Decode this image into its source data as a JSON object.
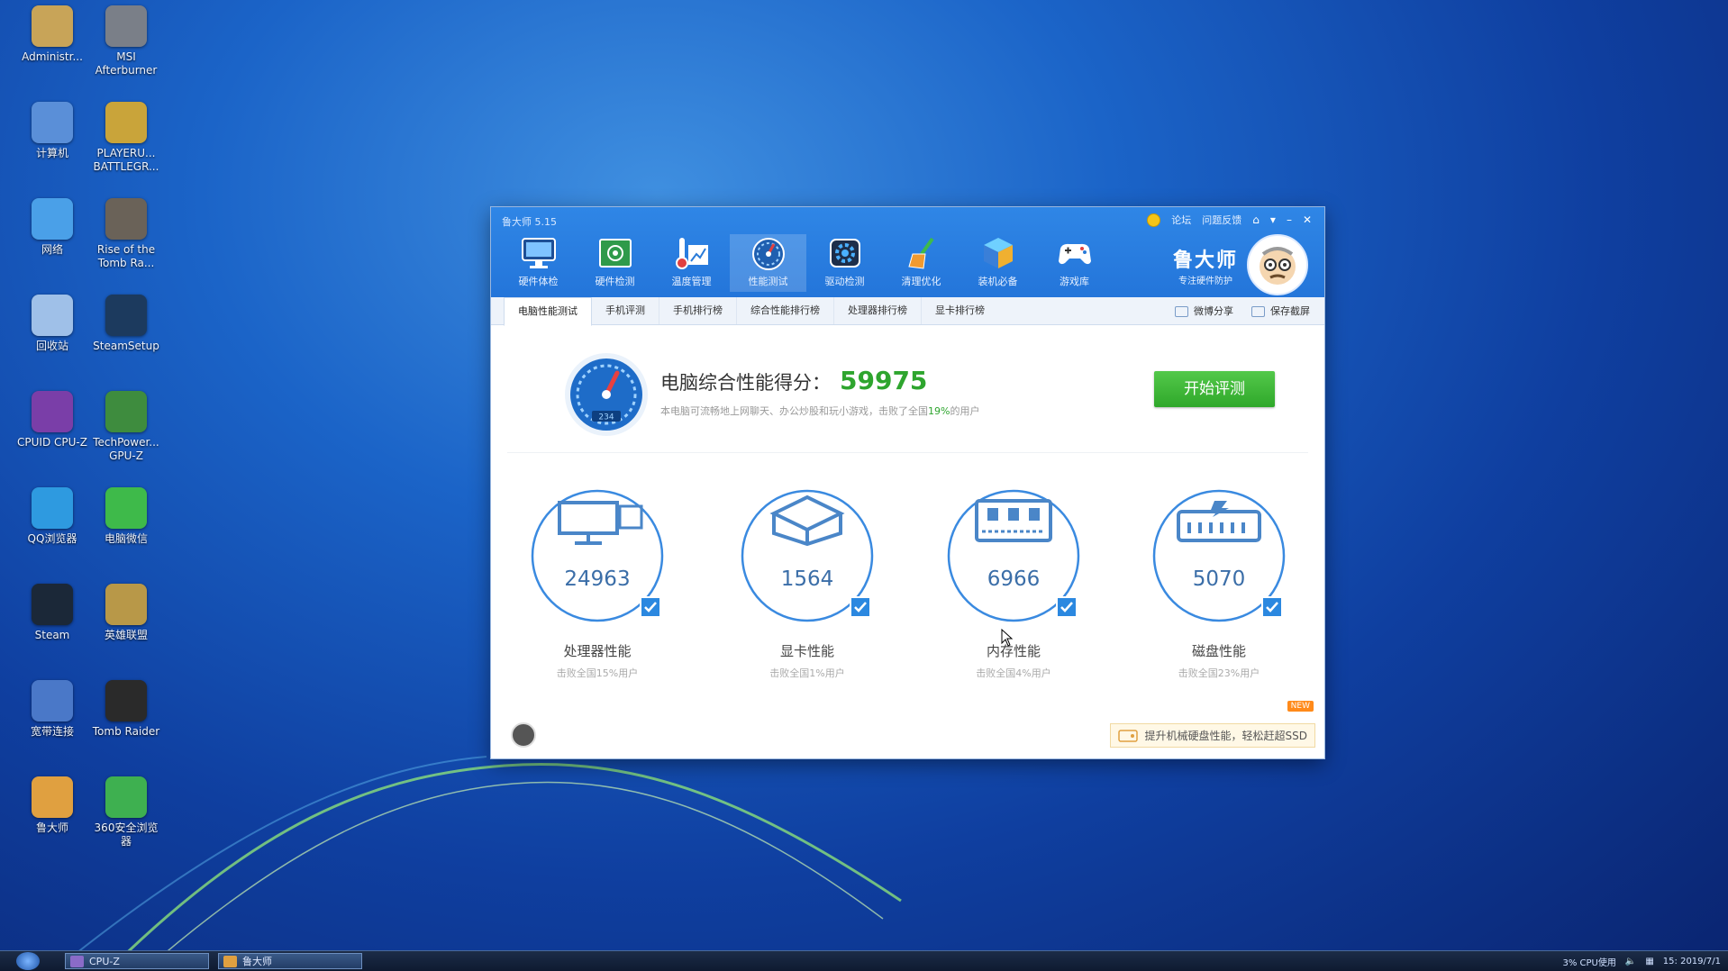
{
  "desktop_icons": [
    {
      "label": "Administr...",
      "color": "#c8a458"
    },
    {
      "label": "MSI Afterburner",
      "color": "#7a7f88"
    },
    {
      "label": "计算机",
      "color": "#5a8fd8"
    },
    {
      "label": "PLAYERU... BATTLEGR...",
      "color": "#c9a43a"
    },
    {
      "label": "网络",
      "color": "#4aa0e8"
    },
    {
      "label": "Rise of the Tomb Ra...",
      "color": "#6a6258"
    },
    {
      "label": "回收站",
      "color": "#9fc0e8"
    },
    {
      "label": "SteamSetup",
      "color": "#1c3a5e"
    },
    {
      "label": "CPUID CPU-Z",
      "color": "#7a3ea8"
    },
    {
      "label": "TechPower... GPU-Z",
      "color": "#3e8c3e"
    },
    {
      "label": "QQ浏览器",
      "color": "#2e9ae0"
    },
    {
      "label": "电脑微信",
      "color": "#3eba4a"
    },
    {
      "label": "Steam",
      "color": "#1b2838"
    },
    {
      "label": "英雄联盟",
      "color": "#b89848"
    },
    {
      "label": "宽带连接",
      "color": "#4a78c8"
    },
    {
      "label": "Tomb Raider",
      "color": "#2a2a2a"
    },
    {
      "label": "鲁大师",
      "color": "#e0a040"
    },
    {
      "label": "360安全浏览器",
      "color": "#3eb050"
    }
  ],
  "window": {
    "title": "鲁大师 5.15",
    "links": [
      "论坛",
      "问题反馈"
    ]
  },
  "toolbar": [
    {
      "label": "硬件体检",
      "icon": "monitor-icon"
    },
    {
      "label": "硬件检测",
      "icon": "chip-icon"
    },
    {
      "label": "温度管理",
      "icon": "thermometer-icon"
    },
    {
      "label": "性能测试",
      "icon": "speedometer-icon"
    },
    {
      "label": "驱动检测",
      "icon": "gear-icon"
    },
    {
      "label": "清理优化",
      "icon": "broom-icon"
    },
    {
      "label": "装机必备",
      "icon": "cube-icon"
    },
    {
      "label": "游戏库",
      "icon": "gamepad-icon"
    }
  ],
  "brand": {
    "name": "鲁大师",
    "slogan": "专注硬件防护"
  },
  "tabs": [
    "电脑性能测试",
    "手机评测",
    "手机排行榜",
    "综合性能排行榜",
    "处理器排行榜",
    "显卡排行榜"
  ],
  "tab_actions": {
    "share": "微博分享",
    "save": "保存截屏"
  },
  "score": {
    "title": "电脑综合性能得分：",
    "value": "59975",
    "sub_prefix": "本电脑可流畅地上网聊天、办公炒股和玩小游戏，击败了全国",
    "sub_pct": "19%",
    "sub_suffix": "的用户",
    "gauge_text": "234"
  },
  "start_button": "开始评测",
  "metrics": [
    {
      "value": "24963",
      "name": "处理器性能",
      "sub": "击败全国15%用户",
      "icon": "cpu-computer-icon"
    },
    {
      "value": "1564",
      "name": "显卡性能",
      "sub": "击败全国1%用户",
      "icon": "graphics-card-icon"
    },
    {
      "value": "6966",
      "name": "内存性能",
      "sub": "击败全国4%用户",
      "icon": "memory-icon"
    },
    {
      "value": "5070",
      "name": "磁盘性能",
      "sub": "击败全国23%用户",
      "icon": "disk-icon"
    }
  ],
  "promo": {
    "text": "提升机械硬盘性能，轻松赶超SSD",
    "badge": "NEW"
  },
  "taskbar": {
    "items": [
      "CPU-Z",
      "鲁大师"
    ],
    "cpu_label": "CPU使用",
    "cpu_pct": "3%",
    "time": "15:",
    "date": "2019/7/1"
  },
  "colors": {
    "accent": "#2a7bd8",
    "score_green": "#2ea52e",
    "button_green": "#3cb535"
  }
}
